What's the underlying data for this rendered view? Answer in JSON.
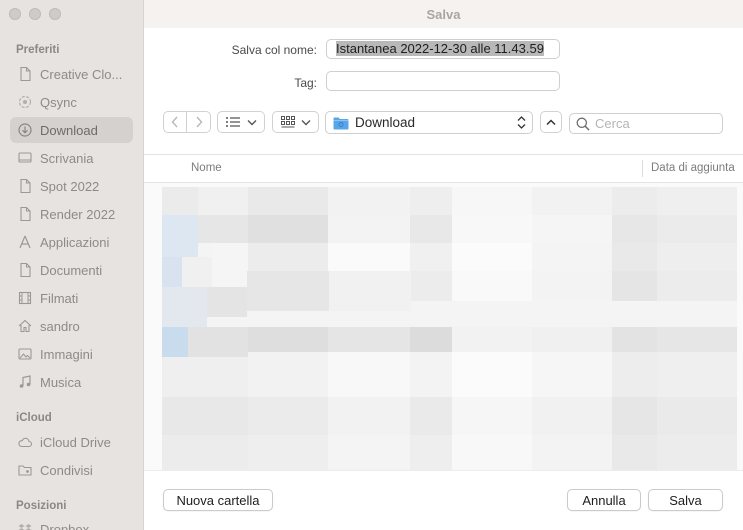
{
  "window": {
    "title": "Salva"
  },
  "sidebar": {
    "sections": [
      {
        "title": "Preferiti"
      },
      {
        "title": "iCloud"
      },
      {
        "title": "Posizioni"
      }
    ],
    "favorites": [
      {
        "label": "Creative Clo...",
        "icon": "document-icon"
      },
      {
        "label": "Qsync",
        "icon": "sync-icon"
      },
      {
        "label": "Download",
        "icon": "download-icon",
        "selected": true
      },
      {
        "label": "Scrivania",
        "icon": "desktop-icon"
      },
      {
        "label": "Spot 2022",
        "icon": "document-icon"
      },
      {
        "label": "Render 2022",
        "icon": "document-icon"
      },
      {
        "label": "Applicazioni",
        "icon": "applications-icon"
      },
      {
        "label": "Documenti",
        "icon": "document-icon"
      },
      {
        "label": "Filmati",
        "icon": "film-icon"
      },
      {
        "label": "sandro",
        "icon": "home-icon"
      },
      {
        "label": "Immagini",
        "icon": "photo-icon"
      },
      {
        "label": "Musica",
        "icon": "music-icon"
      }
    ],
    "icloud": [
      {
        "label": "iCloud Drive",
        "icon": "cloud-icon"
      },
      {
        "label": "Condivisi",
        "icon": "shared-folder-icon"
      }
    ],
    "locations": [
      {
        "label": "Dropbox",
        "icon": "dropbox-icon"
      }
    ]
  },
  "form": {
    "save_as_label": "Salva col nome:",
    "save_as_value": "Istantanea 2022-12-30 alle 11.43.59",
    "tags_label": "Tag:",
    "tags_value": ""
  },
  "toolbar": {
    "location": "Download",
    "search_placeholder": "Cerca"
  },
  "columns": {
    "name": "Nome",
    "date_added": "Data di aggiunta"
  },
  "buttons": {
    "new_folder": "Nuova cartella",
    "cancel": "Annulla",
    "save": "Salva"
  },
  "colors": {
    "sidebar_bg": "#e6e3e1",
    "selected_bg": "#d4d1cf",
    "folder_blue": "#5aa5e8"
  }
}
